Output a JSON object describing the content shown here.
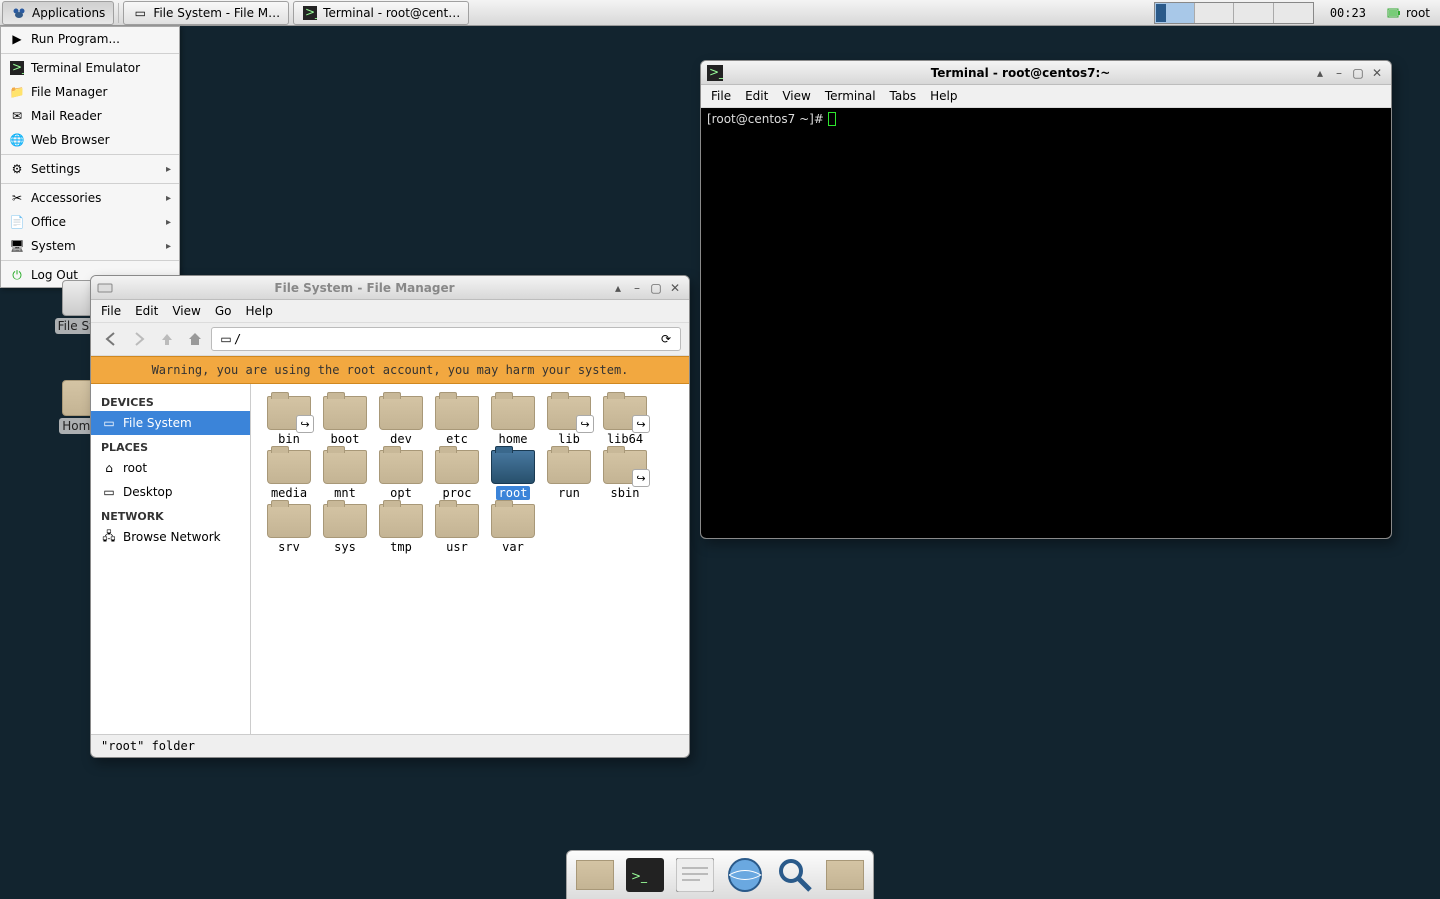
{
  "panel": {
    "apps_button": "Applications",
    "task1": "File System - File M…",
    "task2": "Terminal - root@cent…",
    "clock": "00:23",
    "user": "root"
  },
  "apps_menu": {
    "run": "Run Program...",
    "terminal": "Terminal Emulator",
    "file_manager": "File Manager",
    "mail": "Mail Reader",
    "web": "Web Browser",
    "settings": "Settings",
    "accessories": "Accessories",
    "office": "Office",
    "system": "System",
    "logout": "Log Out"
  },
  "desktop": {
    "fs_label": "File Sys",
    "home_label": "Home"
  },
  "fm": {
    "title": "File System - File Manager",
    "menu": {
      "file": "File",
      "edit": "Edit",
      "view": "View",
      "go": "Go",
      "help": "Help"
    },
    "path": "/",
    "warning": "Warning, you are using the root account, you may harm your system.",
    "side": {
      "devices": "DEVICES",
      "filesystem": "File System",
      "places": "PLACES",
      "root": "root",
      "desktop": "Desktop",
      "network": "NETWORK",
      "browse": "Browse Network"
    },
    "folders": [
      {
        "name": "bin",
        "link": true
      },
      {
        "name": "boot"
      },
      {
        "name": "dev"
      },
      {
        "name": "etc"
      },
      {
        "name": "home"
      },
      {
        "name": "lib",
        "link": true
      },
      {
        "name": "lib64",
        "link": true
      },
      {
        "name": "media"
      },
      {
        "name": "mnt"
      },
      {
        "name": "opt"
      },
      {
        "name": "proc"
      },
      {
        "name": "root",
        "home": true,
        "selected": true
      },
      {
        "name": "run"
      },
      {
        "name": "sbin",
        "link": true
      },
      {
        "name": "srv"
      },
      {
        "name": "sys"
      },
      {
        "name": "tmp"
      },
      {
        "name": "usr"
      },
      {
        "name": "var"
      }
    ],
    "status": "\"root\" folder"
  },
  "term": {
    "title": "Terminal - root@centos7:~",
    "menu": {
      "file": "File",
      "edit": "Edit",
      "view": "View",
      "terminal": "Terminal",
      "tabs": "Tabs",
      "help": "Help"
    },
    "prompt": "[root@centos7 ~]# "
  }
}
